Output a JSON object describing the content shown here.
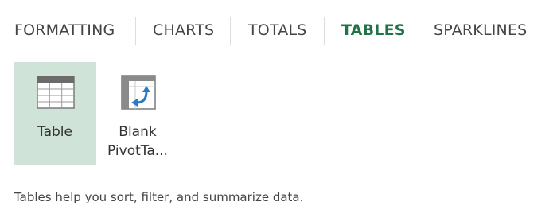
{
  "tabs": [
    {
      "label": "FORMATTING",
      "active": false
    },
    {
      "label": "CHARTS",
      "active": false
    },
    {
      "label": "TOTALS",
      "active": false
    },
    {
      "label": "TABLES",
      "active": true
    },
    {
      "label": "SPARKLINES",
      "active": false
    }
  ],
  "tiles": [
    {
      "line1": "Table",
      "line2": "",
      "icon": "table-icon",
      "selected": true
    },
    {
      "line1": "Blank",
      "line2": "PivotTa...",
      "icon": "pivot-table-icon",
      "selected": false
    }
  ],
  "help_text": "Tables help you sort, filter, and summarize data.",
  "colors": {
    "accent": "#217346",
    "selected_tile": "#cfe3d9",
    "pivot_arrow": "#2b78c5",
    "text": "#444444"
  }
}
